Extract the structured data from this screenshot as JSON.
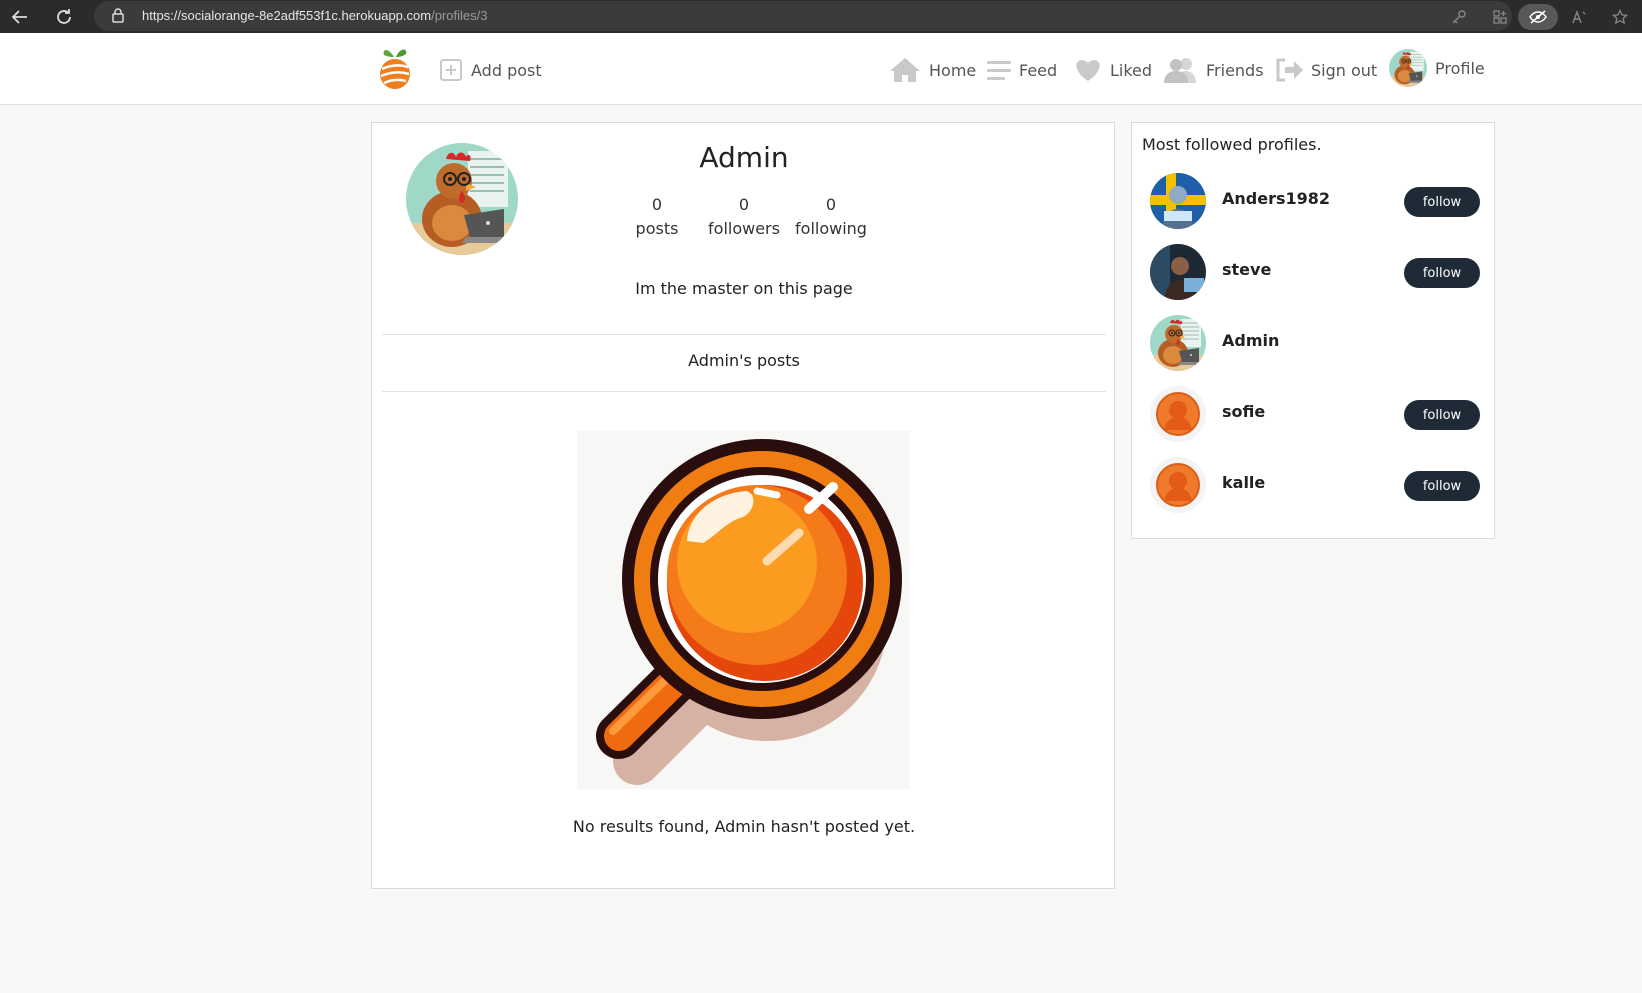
{
  "browser": {
    "url_host": "https://socialorange-8e2adf553f1c.herokuapp.com",
    "url_path": "/profiles/3"
  },
  "navbar": {
    "add_post": "Add post",
    "home": "Home",
    "feed": "Feed",
    "liked": "Liked",
    "friends": "Friends",
    "sign_out": "Sign out",
    "profile": "Profile"
  },
  "profile": {
    "name": "Admin",
    "stats": [
      {
        "value": "0",
        "label": "posts"
      },
      {
        "value": "0",
        "label": "followers"
      },
      {
        "value": "0",
        "label": "following"
      }
    ],
    "bio": "Im the master on this page",
    "posts_title": "Admin's posts",
    "no_results": "No results found, Admin hasn't posted yet."
  },
  "sidebar": {
    "title": "Most followed profiles.",
    "follow_label": "follow",
    "profiles": [
      {
        "username": "Anders1982",
        "avatar": "sweden-coder",
        "followable": true
      },
      {
        "username": "steve",
        "avatar": "night-coder",
        "followable": true
      },
      {
        "username": "Admin",
        "avatar": "chicken",
        "followable": false
      },
      {
        "username": "sofie",
        "avatar": "default-orange",
        "followable": true
      },
      {
        "username": "kalle",
        "avatar": "default-orange",
        "followable": true
      }
    ]
  },
  "colors": {
    "accent": "#f26b1d",
    "button_dark": "#1f2a37",
    "nav_icon": "#c9c9c9"
  }
}
